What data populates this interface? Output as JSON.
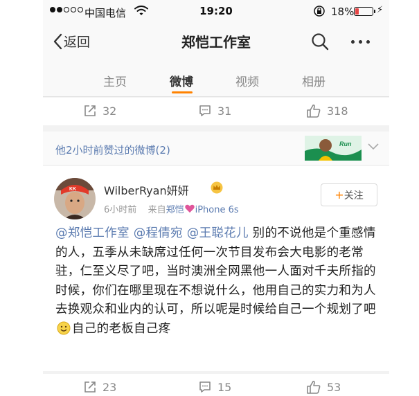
{
  "status_bar": {
    "carrier": "中国电信",
    "time": "19:20",
    "battery_percent": "18%"
  },
  "nav": {
    "back_label": "返回",
    "title": "郑恺工作室"
  },
  "tabs": [
    {
      "label": "主页"
    },
    {
      "label": "微博"
    },
    {
      "label": "视频"
    },
    {
      "label": "相册"
    }
  ],
  "top_actions": {
    "reposts": "32",
    "comments": "31",
    "likes": "318"
  },
  "section": {
    "title": "他2小时前赞过的微博(2)"
  },
  "post": {
    "username": "WilberRyan妍妍",
    "time": "6小时前",
    "source_prefix": "来自",
    "source_name": "郑恺",
    "source_device": "iPhone 6s",
    "follow_label": "关注",
    "mention1": "@郑恺工作室",
    "mention2": "@程倩宛",
    "mention3": "@王聪花儿",
    "text_part1": "别的不说他是个重感情的人，五季从未缺席过任何一次节目发布会大电影的老常驻，仁至义尽了吧，当时澳洲全网黑他一人面对千夫所指的时候，你们在哪里现在不想说什么，他用自己的实力和为人去换观众和业内的认可，所以呢是时候给自己一个规划了吧",
    "text_part2": "自己的老板自己疼"
  },
  "bottom_actions": {
    "reposts": "23",
    "comments": "15",
    "likes": "53"
  },
  "colors": {
    "accent": "#ff8200",
    "link": "#5b7bb0",
    "battery_low": "#e84545"
  },
  "icons": [
    "signal-dots-icon",
    "wifi-icon",
    "lock-rotation-icon",
    "battery-icon",
    "back-chevron-icon",
    "search-icon",
    "more-icon",
    "repost-icon",
    "comment-icon",
    "like-icon",
    "chevron-down-icon",
    "crown-badge-icon",
    "heart-icon",
    "smile-emoji-icon"
  ]
}
